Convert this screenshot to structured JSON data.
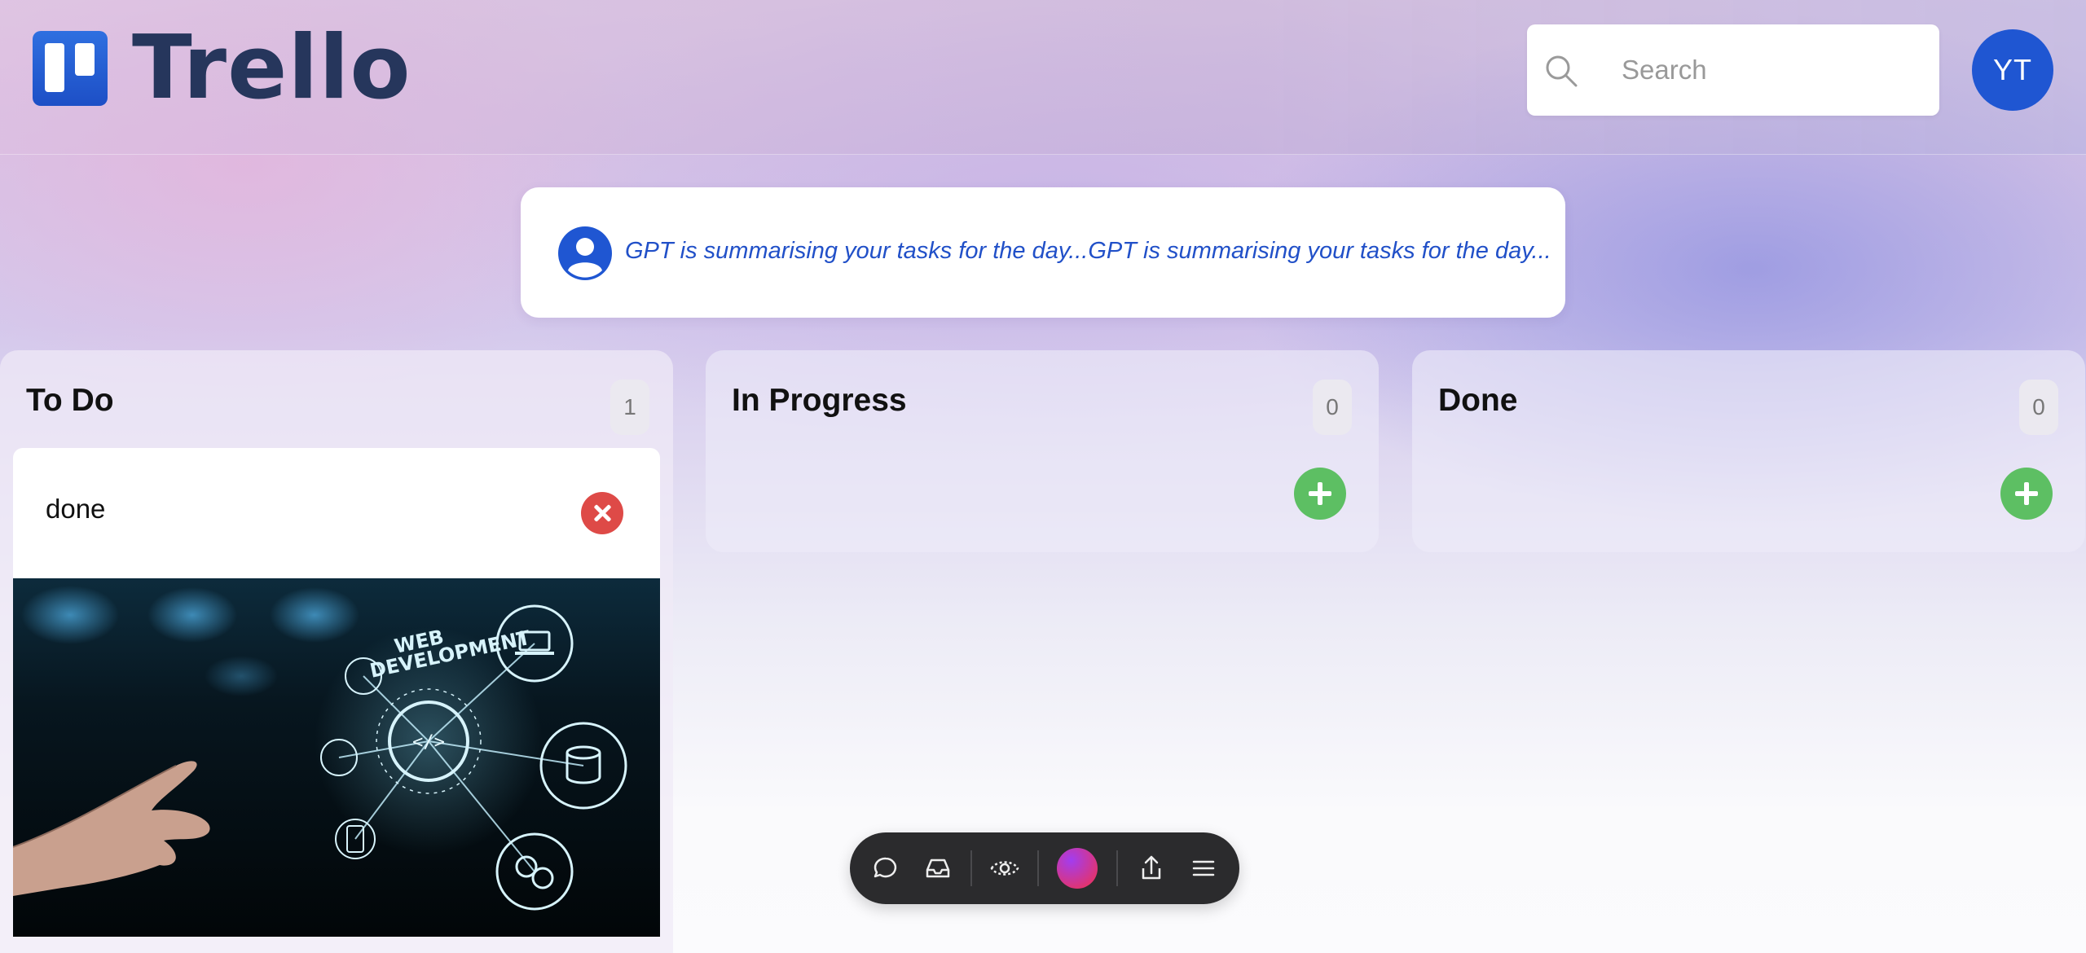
{
  "header": {
    "logo_text": "Trello",
    "search_placeholder": "Search",
    "avatar_initials": "YT"
  },
  "gpt_banner": {
    "text": "GPT is summarising your tasks for the day...GPT is summarising your tasks for the day..."
  },
  "columns": [
    {
      "title": "To Do",
      "count": "1",
      "cards": [
        {
          "title": "done",
          "image_caption": "WEB DEVELOPMENT"
        }
      ]
    },
    {
      "title": "In Progress",
      "count": "0",
      "cards": []
    },
    {
      "title": "Done",
      "count": "0",
      "cards": []
    }
  ],
  "toolbar": {
    "items": [
      "comment-icon",
      "inbox-icon",
      "eye-icon",
      "color-picker",
      "share-icon",
      "menu-icon"
    ]
  },
  "colors": {
    "brand_blue": "#1f56d2",
    "add_green": "#5dbf63",
    "delete_red": "#de4a47",
    "logo_text": "#26365c"
  }
}
